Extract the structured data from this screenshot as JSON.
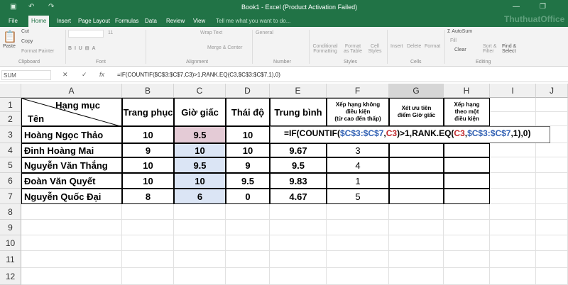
{
  "window": {
    "title": "Book1 - Excel (Product Activation Failed)",
    "watermark": "ThuthuatOffice"
  },
  "tabs": [
    "File",
    "Home",
    "Insert",
    "Page Layout",
    "Formulas",
    "Data",
    "Review",
    "View"
  ],
  "tell_me": "Tell me what you want to do...",
  "ribbon": {
    "paste": "Paste",
    "cut": "Cut",
    "copy": "Copy",
    "format_painter": "Format Painter",
    "clipboard": "Clipboard",
    "font_size": "11",
    "font": "Font",
    "wrap_text": "Wrap Text",
    "merge_center": "Merge & Center",
    "alignment": "Alignment",
    "number_format": "General",
    "number": "Number",
    "conditional_formatting": "Conditional Formatting",
    "format_as_table": "Format as Table",
    "cell_styles": "Cell Styles",
    "styles": "Styles",
    "insert": "Insert",
    "delete": "Delete",
    "format": "Format",
    "cells": "Cells",
    "autosum": "AutoSum",
    "fill": "Fill",
    "clear": "Clear",
    "sort_filter": "Sort & Filter",
    "find_select": "Find & Select",
    "editing": "Editing"
  },
  "formula_bar": {
    "name_box": "SUM",
    "formula": "=IF(COUNTIF($C$3:$C$7,C3)>1,RANK.EQ(C3,$C$3:$C$7,1),0)"
  },
  "columns": [
    "A",
    "B",
    "C",
    "D",
    "E",
    "F",
    "G",
    "H",
    "I",
    "J"
  ],
  "rows": [
    "1",
    "2",
    "3",
    "4",
    "5",
    "6",
    "7",
    "8",
    "9",
    "10",
    "11",
    "12"
  ],
  "headers": {
    "hang_muc": "Hạng mục",
    "ten": "Tên",
    "b": "Trang phục",
    "c": "Giờ giấc",
    "d": "Thái độ",
    "e": "Trung bình",
    "f1": "Xếp hạng không",
    "f2": "điều kiện",
    "f3": "(từ cao đến thấp)",
    "g1": "Xét ưu tiên",
    "g2": "điểm Giờ giấc",
    "h1": "Xếp hạng",
    "h2": "theo một",
    "h3": "điều kiện"
  },
  "data": [
    {
      "name": "Hoàng Ngọc Thảo",
      "b": "10",
      "c": "9.5",
      "d": "10",
      "e": "",
      "f": ""
    },
    {
      "name": "Đinh Hoàng Mai",
      "b": "9",
      "c": "10",
      "d": "10",
      "e": "9.67",
      "f": "3"
    },
    {
      "name": "Nguyễn Văn Thắng",
      "b": "10",
      "c": "9.5",
      "d": "9",
      "e": "9.5",
      "f": "4"
    },
    {
      "name": "Đoàn Văn Quyết",
      "b": "10",
      "c": "10",
      "d": "9.5",
      "e": "9.83",
      "f": "1"
    },
    {
      "name": "Nguyễn Quốc Đại",
      "b": "8",
      "c": "6",
      "d": "0",
      "e": "4.67",
      "f": "5"
    }
  ],
  "edit_formula": {
    "p1": "=IF(COUNTIF(",
    "p2": "$C$3:$C$7",
    "p3": ",",
    "p4": "C3",
    "p5": ")>1,RANK.EQ(",
    "p6": "C3",
    "p7": ",",
    "p8": "$C$3:$C$7",
    "p9": ",1),0)"
  }
}
